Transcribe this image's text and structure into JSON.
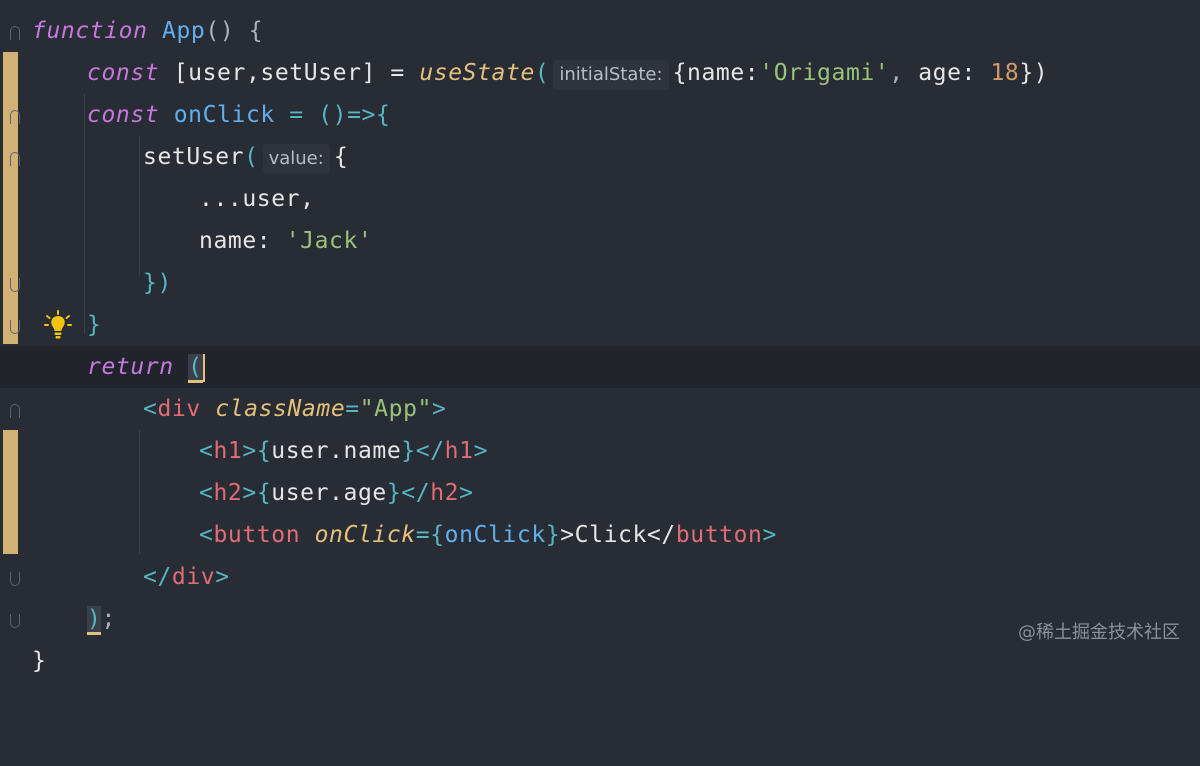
{
  "editor": {
    "lines": {
      "l1": {
        "t1": "function",
        "t2": "App",
        "t3": "() {"
      },
      "l2": {
        "t1": "const",
        "t2": "[user,setUser] =",
        "t3": "useState",
        "t4": "(",
        "hint": "initialState:",
        "t5": "{",
        "t6": "name:",
        "t7": "'Origami'",
        "t8": ",",
        "t9": "age:",
        "t10": "18",
        "t11": "})"
      },
      "l3": {
        "t1": "const",
        "t2": "onClick",
        "t3": "=",
        "t4": "()=>{"
      },
      "l4": {
        "t1": "setUser",
        "t2": "(",
        "hint": "value:",
        "t3": "{"
      },
      "l5": {
        "t1": "...user,"
      },
      "l6": {
        "t1": "name:",
        "t2": "'Jack'"
      },
      "l7": {
        "t1": "})"
      },
      "l8": {
        "t1": "}"
      },
      "l9": {
        "t1": "return",
        "t2": "("
      },
      "l10": {
        "t1": "<",
        "t2": "div",
        "t3": "className",
        "t4": "=",
        "t5": "\"App\"",
        "t6": ">"
      },
      "l11": {
        "t1": "<",
        "t2": "h1",
        "t3": ">",
        "t4": "{",
        "t5": "user.name",
        "t6": "}",
        "t7": "</",
        "t8": "h1",
        "t9": ">"
      },
      "l12": {
        "t1": "<",
        "t2": "h2",
        "t3": ">",
        "t4": "{",
        "t5": "user.age",
        "t6": "}",
        "t7": "</",
        "t8": "h2",
        "t9": ">"
      },
      "l13": {
        "t1": "<",
        "t2": "button",
        "t3": "onClick",
        "t4": "=",
        "t5": "{",
        "t6": "onClick",
        "t7": "}",
        "t8": ">Click</",
        "t9": "button",
        "t10": ">"
      },
      "l14": {
        "t1": "</",
        "t2": "div",
        "t3": ">"
      },
      "l15": {
        "t1": ")",
        "t2": ";"
      },
      "l16": {
        "t1": "}"
      }
    },
    "intention_icon": "lightbulb-icon",
    "colors": {
      "background": "#282c34",
      "current_line": "#21252b",
      "keyword": "#c678dd",
      "function": "#61afef",
      "string": "#98c379",
      "number": "#d19a66",
      "tag": "#e06c75",
      "attribute": "#e5c07b",
      "modified_gutter": "#e5c07b"
    }
  },
  "watermark": "@稀土掘金技术社区"
}
